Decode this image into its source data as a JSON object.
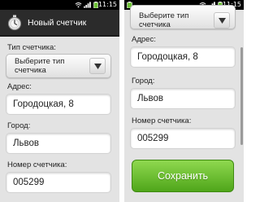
{
  "status_bar": {
    "time": "11:15"
  },
  "left_screen": {
    "app_title": "Новый счетчик",
    "type_label": "Тип счетчика:",
    "type_spinner_text": "Выберите тип счетчика",
    "address_label": "Адрес:",
    "address_value": "Городоцкая, 8",
    "city_label": "Город:",
    "city_value": "Львов",
    "number_label": "Номер счетчика:",
    "number_value": "005299"
  },
  "right_screen": {
    "type_spinner_text": "Выберите тип счетчика",
    "address_label": "Адрес:",
    "address_value": "Городоцкая, 8",
    "city_label": "Город:",
    "city_value": "Львов",
    "number_label": "Номер счетчика:",
    "number_value": "005299",
    "save_label": "Сохранить"
  },
  "colors": {
    "action_bar": "#2b2b2b",
    "content_bg": "#e3e3e3",
    "save_button": "#6cc234",
    "status_bar": "#000000"
  },
  "icons": [
    "wifi-icon",
    "signal-icon",
    "battery-icon",
    "stopwatch-icon",
    "chevron-down-icon"
  ]
}
